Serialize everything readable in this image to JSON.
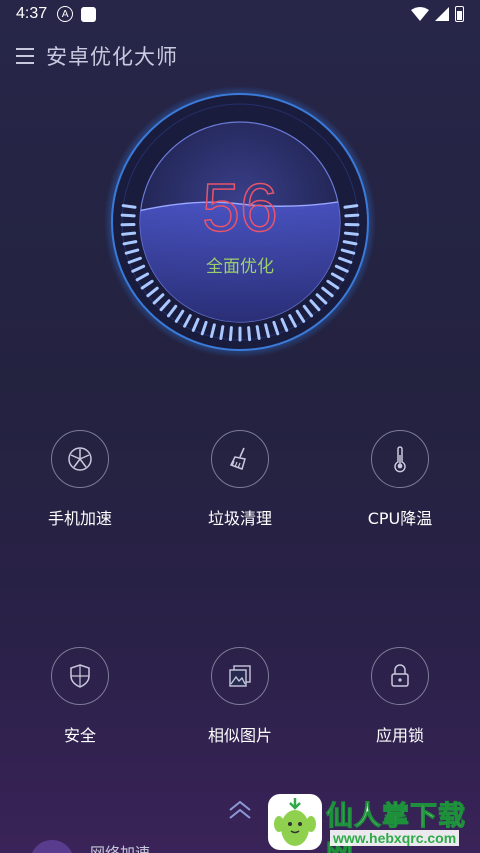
{
  "status_bar": {
    "time": "4:37",
    "icons": [
      "a-circle-icon",
      "square-notification-icon",
      "wifi-icon",
      "signal-icon",
      "battery-icon"
    ]
  },
  "app_bar": {
    "title": "安卓优化大师",
    "menu_icon": "menu-icon"
  },
  "gauge": {
    "score": "56",
    "action_label": "全面优化",
    "accent_color": "#e8546a",
    "label_color": "#9ccf6a"
  },
  "tools": [
    {
      "label": "手机加速",
      "icon": "fan-icon"
    },
    {
      "label": "垃圾清理",
      "icon": "broom-icon"
    },
    {
      "label": "CPU降温",
      "icon": "thermometer-icon"
    },
    {
      "label": "安全",
      "icon": "shield-icon"
    },
    {
      "label": "相似图片",
      "icon": "photos-icon"
    },
    {
      "label": "应用锁",
      "icon": "lock-icon"
    }
  ],
  "bottom": {
    "expand_icon": "double-chevron-up-icon",
    "partial_text": "网络加速"
  },
  "watermark": {
    "text": "仙人掌下载网",
    "url": "www.hebxqrc.com"
  }
}
